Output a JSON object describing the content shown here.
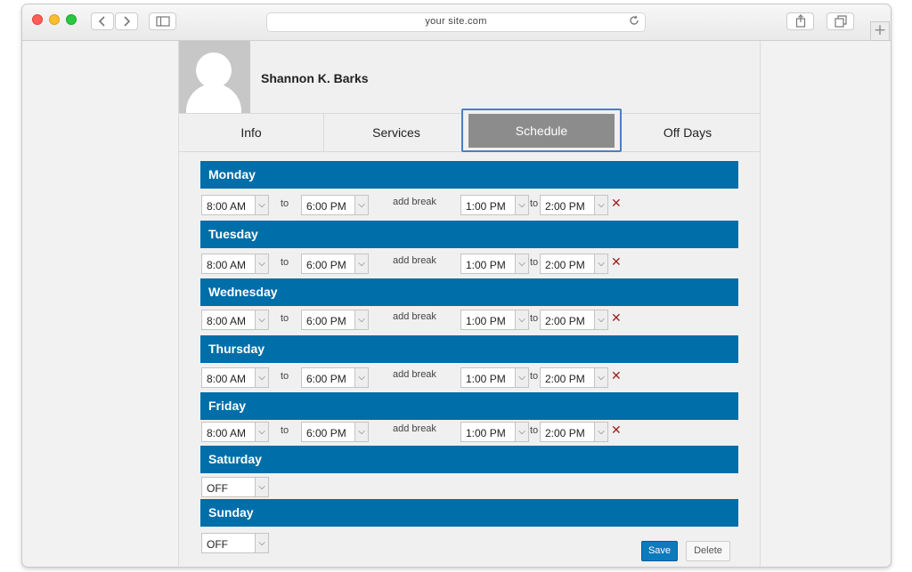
{
  "browser": {
    "url": "your site.com",
    "back_icon": "chevron-left-icon",
    "forward_icon": "chevron-right-icon",
    "sidebar_icon": "sidebar-icon",
    "reload_icon": "reload-icon",
    "share_icon": "share-icon",
    "tabs_icon": "tabs-icon",
    "new_tab_label": "+"
  },
  "profile": {
    "name": "Shannon K. Barks"
  },
  "tabs": [
    "Info",
    "Services",
    "Schedule",
    "Off Days"
  ],
  "active_tab": "Schedule",
  "days": [
    {
      "name": "Monday",
      "start": "8:00 AM",
      "to": "to",
      "end": "6:00 PM",
      "break_label": "add break",
      "break_start": "1:00 PM",
      "break_to": "to",
      "break_end": "2:00 PM",
      "remove": "✕"
    },
    {
      "name": "Tuesday",
      "start": "8:00 AM",
      "to": "to",
      "end": "6:00 PM",
      "break_label": "add break",
      "break_start": "1:00 PM",
      "break_to": "to",
      "break_end": "2:00 PM",
      "remove": "✕"
    },
    {
      "name": "Wednesday",
      "start": "8:00 AM",
      "to": "to",
      "end": "6:00 PM",
      "break_label": "add break",
      "break_start": "1:00 PM",
      "break_to": "to",
      "break_end": "2:00 PM",
      "remove": "✕"
    },
    {
      "name": "Thursday",
      "start": "8:00 AM",
      "to": "to",
      "end": "6:00 PM",
      "break_label": "add break",
      "break_start": "1:00 PM",
      "break_to": "to",
      "break_end": "2:00 PM",
      "remove": "✕"
    },
    {
      "name": "Friday",
      "start": "8:00 AM",
      "to": "to",
      "end": "6:00 PM",
      "break_label": "add break",
      "break_start": "1:00 PM",
      "break_to": "to",
      "break_end": "2:00 PM",
      "remove": "✕"
    },
    {
      "name": "Saturday",
      "start": "OFF"
    },
    {
      "name": "Sunday",
      "start": "OFF"
    }
  ],
  "actions": {
    "save": "Save",
    "delete": "Delete"
  },
  "colors": {
    "day_header": "#006ea8",
    "active_tab": "#8c8c8c",
    "save_button": "#0b7bbd",
    "remove_icon": "#a02020"
  }
}
